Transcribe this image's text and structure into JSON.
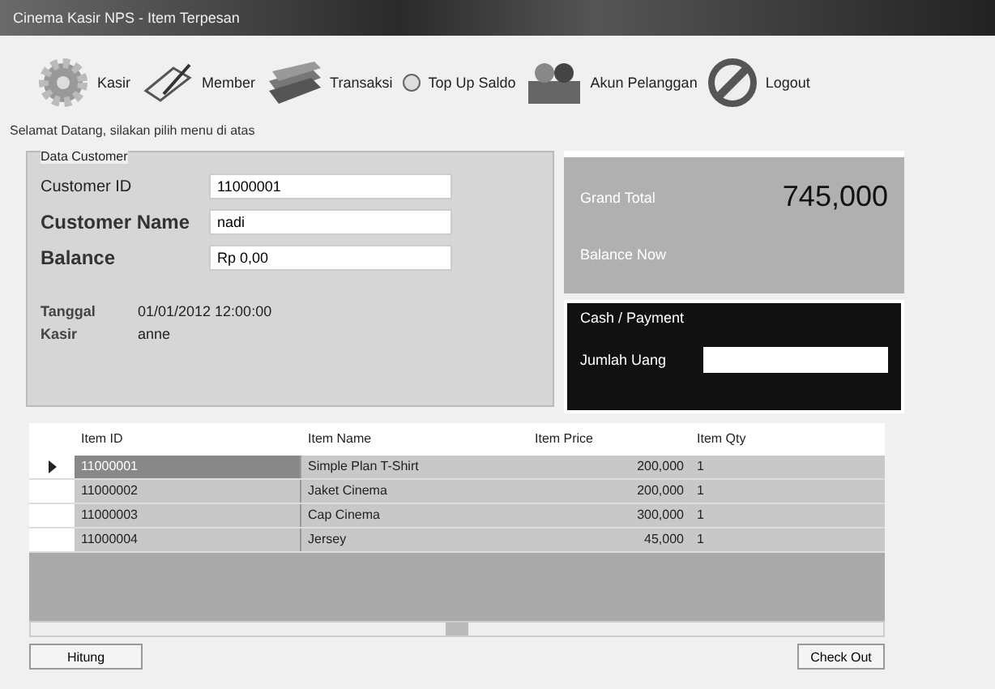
{
  "window": {
    "title": "Cinema Kasir NPS - Item Terpesan"
  },
  "toolbar": [
    {
      "label": "Kasir",
      "kind": "gear"
    },
    {
      "label": "Member",
      "kind": "pen"
    },
    {
      "label": "Transaksi",
      "kind": "money"
    },
    {
      "label": "Top Up Saldo",
      "kind": "small"
    },
    {
      "label": "Akun Pelanggan",
      "kind": "people"
    },
    {
      "label": "Logout",
      "kind": "stop"
    }
  ],
  "status": "Selamat Datang, silakan pilih menu di atas",
  "customer": {
    "title": "Data Customer",
    "fields": [
      {
        "label": "Customer ID",
        "value": "11000001",
        "emphasis": false
      },
      {
        "label": "Customer Name",
        "value": "nadi",
        "emphasis": true
      },
      {
        "label": "Balance",
        "value": "Rp 0,00",
        "emphasis": true
      }
    ],
    "info": [
      {
        "label": "Tanggal",
        "value": "01/01/2012 12:00:00"
      },
      {
        "label": "Kasir",
        "value": "anne"
      }
    ]
  },
  "totals": {
    "grand_total_label": "Grand Total",
    "grand_total": "745,000",
    "balance_label": "Balance Now"
  },
  "payment": {
    "title": "Cash / Payment",
    "label": "Jumlah Uang"
  },
  "table": {
    "columns": [
      "Item ID",
      "Item Name",
      "Item Price",
      "Item Qty"
    ],
    "rows": [
      {
        "cells": [
          "11000001",
          "Simple Plan T-Shirt",
          "200,000",
          "1"
        ],
        "selected": true
      },
      {
        "cells": [
          "11000002",
          "Jaket Cinema",
          "200,000",
          "1"
        ],
        "selected": false
      },
      {
        "cells": [
          "11000003",
          "Cap Cinema",
          "300,000",
          "1"
        ],
        "selected": false
      },
      {
        "cells": [
          "11000004",
          "Jersey",
          "45,000",
          "1"
        ],
        "selected": false
      }
    ]
  },
  "buttons": [
    "Hitung",
    "Check Out"
  ]
}
